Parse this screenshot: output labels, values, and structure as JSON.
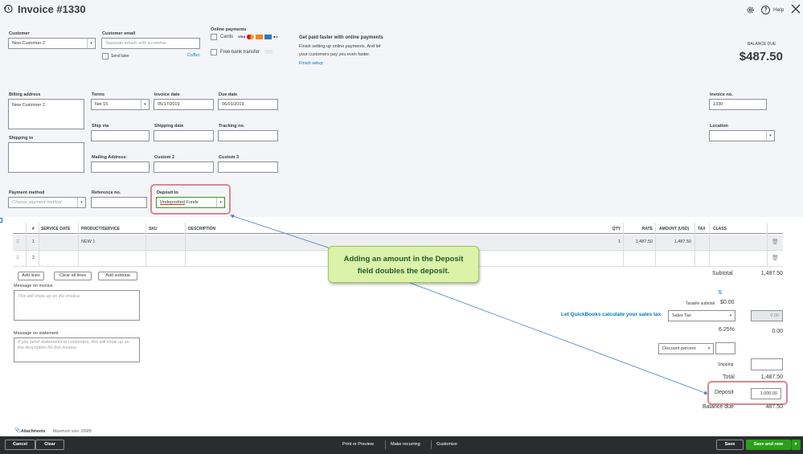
{
  "title": "Invoice #1330",
  "header": {
    "help_label": "Help"
  },
  "customer": {
    "label": "Customer",
    "value": "New Customer 2"
  },
  "email": {
    "label": "Customer email",
    "placeholder": "Separate emails with a comma",
    "send_later": "Send later",
    "cc_bcc": "Cc/Bcc"
  },
  "online_payments": {
    "label": "Online payments",
    "cards": "Cards",
    "bank": "Free bank transfer"
  },
  "promo": {
    "title": "Get paid faster with online payments",
    "body1": "Finish setting up online payments. And let",
    "body2": "your customers pay you even faster.",
    "link": "Finish setup"
  },
  "balance": {
    "label": "BALANCE DUE",
    "amount": "$487.50"
  },
  "billing": {
    "label": "Billing address",
    "value": "New Customer 2"
  },
  "terms": {
    "label": "Terms",
    "value": "Net 15"
  },
  "invoice_date": {
    "label": "Invoice date",
    "value": "05/17/2019"
  },
  "due_date": {
    "label": "Due date",
    "value": "06/01/2019"
  },
  "invoice_no": {
    "label": "Invoice no.",
    "value": "1330"
  },
  "ship_via": {
    "label": "Ship via"
  },
  "shipping_date": {
    "label": "Shipping date"
  },
  "tracking": {
    "label": "Tracking no."
  },
  "location": {
    "label": "Location"
  },
  "shipping_to": {
    "label": "Shipping to"
  },
  "mailing": {
    "label": "Mailing Address:"
  },
  "custom2": {
    "label": "Custom 2"
  },
  "custom3": {
    "label": "Custom 3"
  },
  "payment_method": {
    "label": "Payment method",
    "placeholder": "Choose payment method"
  },
  "reference": {
    "label": "Reference no."
  },
  "deposit_to": {
    "label": "Deposit to",
    "value_a": "Undeposited",
    "value_b": " Funds"
  },
  "table": {
    "headers": {
      "num": "#",
      "service_date": "SERVICE DATE",
      "product": "PRODUCT/SERVICE",
      "sku": "SKU",
      "description": "DESCRIPTION",
      "qty": "QTY",
      "rate": "RATE",
      "amount": "AMOUNT (USD)",
      "tax": "TAX",
      "class": "CLASS"
    },
    "rows": [
      {
        "num": "1",
        "product": "NEW 1",
        "qty": "1",
        "rate": "1,487.50",
        "amount": "1,487.50"
      },
      {
        "num": "2",
        "product": "",
        "qty": "",
        "rate": "",
        "amount": ""
      }
    ]
  },
  "buttons": {
    "add_lines": "Add lines",
    "clear_lines": "Clear all lines",
    "add_subtotal": "Add subtotal"
  },
  "message_invoice": {
    "label": "Message on invoice",
    "placeholder": "This will show up on the invoice."
  },
  "message_statement": {
    "label": "Message on statement",
    "placeholder": "If you send statements to customers, this will show up as the description for this invoice."
  },
  "totals": {
    "subtotal_label": "Subtotal",
    "subtotal_value": "1,487.50",
    "taxable_label": "Taxable subtotal",
    "taxable_value": "$0.00",
    "tax_link": "Let QuickBooks calculate your sales tax",
    "tax_select": "Sales Tax",
    "tax_amount_box": "0.00",
    "tax_rate": "6.25%",
    "tax_value": "0.00",
    "discount_select": "Discount percent",
    "shipping_label": "Shipping",
    "total_label": "Total",
    "total_value": "1,487.50",
    "deposit_label": "Deposit",
    "deposit_value": "1,000.00",
    "balance_label": "Balance due",
    "balance_value": "487.50"
  },
  "attachments": {
    "label": "Attachments",
    "max": "Maximum size: 20MB"
  },
  "callout": {
    "line1": "Adding an amount in the Deposit",
    "line2": "field doubles the deposit."
  },
  "footer": {
    "cancel": "Cancel",
    "clear": "Clear",
    "print": "Print or Preview",
    "recurring": "Make recurring",
    "customize": "Customize",
    "save": "Save",
    "save_new": "Save and new"
  },
  "colors": {
    "green": "#2ca01c",
    "link": "#0077c5",
    "highlight": "#d9888f",
    "callout_bg": "#dbf2a8"
  }
}
